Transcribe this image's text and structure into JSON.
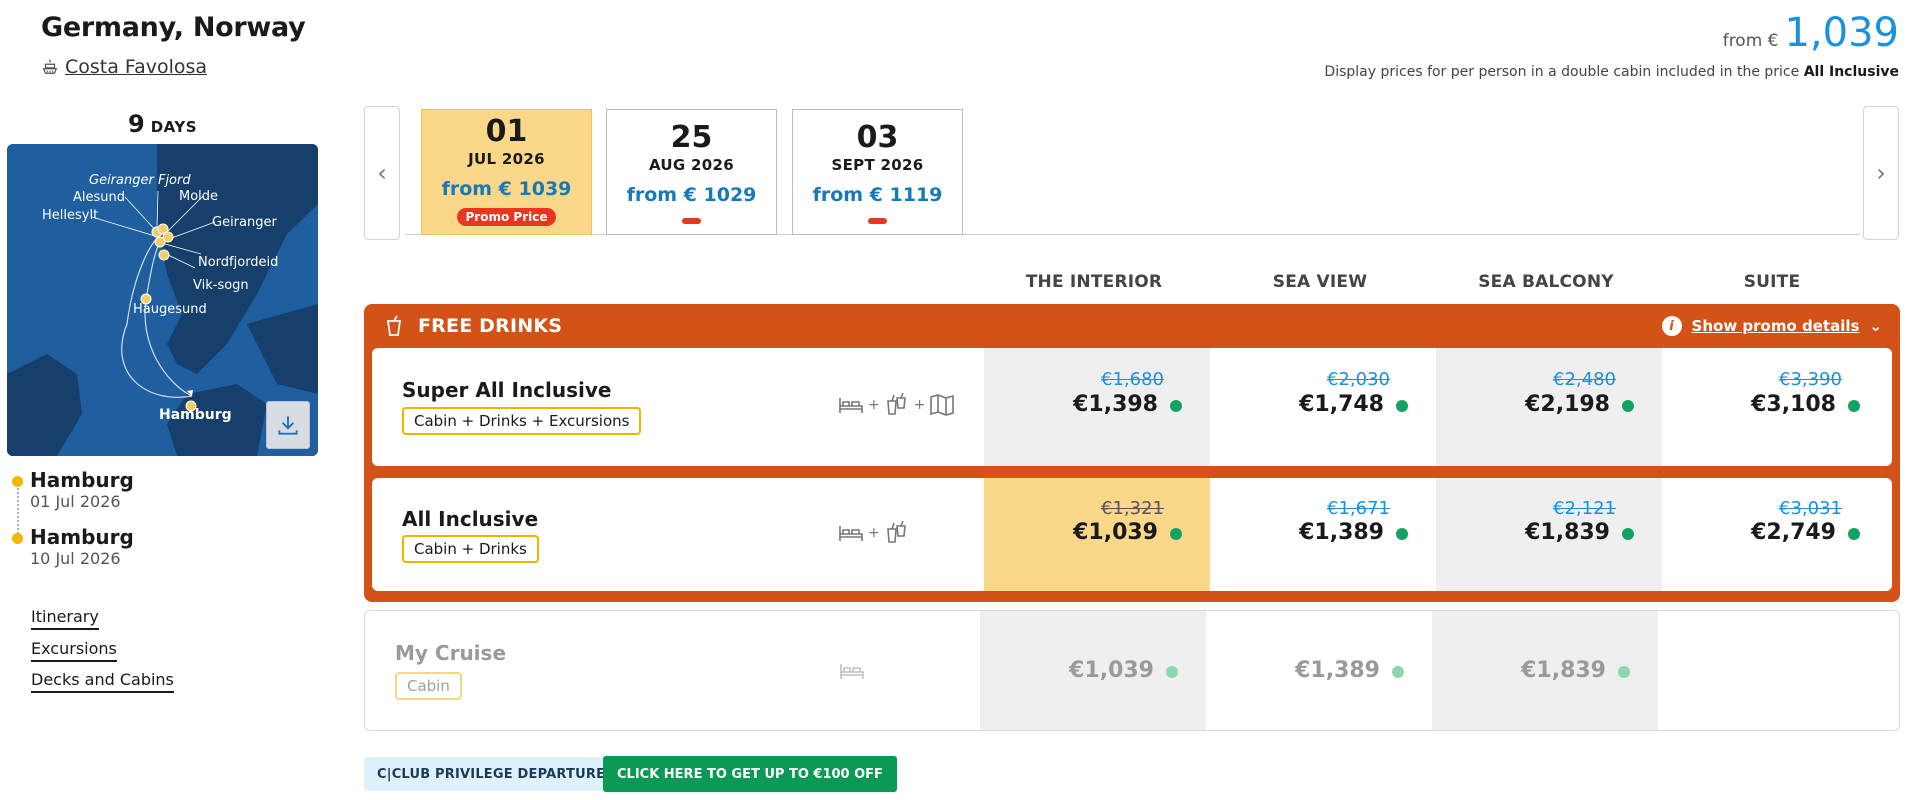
{
  "header": {
    "destination": "Germany, Norway",
    "ship_name": "Costa Favolosa",
    "from_label": "from €",
    "from_price": "1,039",
    "display_note_prefix": "Display prices for per person in a double cabin included in the price",
    "display_note_bold": "All Inclusive"
  },
  "trip": {
    "days_number": "9",
    "days_label": "DAYS",
    "map_labels": {
      "geiranger_fjord": "Geiranger Fjord",
      "alesund": "Alesund",
      "molde": "Molde",
      "hellesylt": "Hellesylt",
      "geiranger": "Geiranger",
      "nordfjordeid": "Nordfjordeid",
      "vik_sogn": "Vik-sogn",
      "haugesund": "Haugesund",
      "hamburg": "Hamburg"
    },
    "departure": {
      "port": "Hamburg",
      "date": "01 Jul 2026"
    },
    "arrival": {
      "port": "Hamburg",
      "date": "10 Jul 2026"
    }
  },
  "side_links": [
    "Itinerary",
    "Excursions",
    "Decks and Cabins"
  ],
  "dates": [
    {
      "day": "01",
      "month": "JUL 2026",
      "price": "from € 1039",
      "badge": "Promo Price",
      "active": true
    },
    {
      "day": "25",
      "month": "AUG 2026",
      "price": "from € 1029",
      "badge": "",
      "active": false
    },
    {
      "day": "03",
      "month": "SEPT 2026",
      "price": "from € 1119",
      "badge": "",
      "active": false
    }
  ],
  "nav": {
    "prev": "‹",
    "next": "›"
  },
  "columns": [
    "THE INTERIOR",
    "SEA VIEW",
    "SEA BALCONY",
    "SUITE"
  ],
  "promo": {
    "title": "FREE DRINKS",
    "details_link": "Show promo details",
    "info_glyph": "i",
    "chevron": "⌄"
  },
  "packages": [
    {
      "name": "Super All Inclusive",
      "tag": "Cabin + Drinks + Excursions",
      "icons": [
        "bed-icon",
        "drinks-icon",
        "map-icon"
      ],
      "plus": "+",
      "prices": [
        {
          "old": "€1,680",
          "new": "€1,398"
        },
        {
          "old": "€2,030",
          "new": "€1,748"
        },
        {
          "old": "€2,480",
          "new": "€2,198"
        },
        {
          "old": "€3,390",
          "new": "€3,108"
        }
      ]
    },
    {
      "name": "All Inclusive",
      "tag": "Cabin + Drinks",
      "icons": [
        "bed-icon",
        "drinks-icon"
      ],
      "plus": "+",
      "prices": [
        {
          "old": "€1,321",
          "new": "€1,039"
        },
        {
          "old": "€1,671",
          "new": "€1,389"
        },
        {
          "old": "€2,121",
          "new": "€1,839"
        },
        {
          "old": "€3,031",
          "new": "€2,749"
        }
      ]
    },
    {
      "name": "My Cruise",
      "tag": "Cabin",
      "icons": [
        "bed-icon"
      ],
      "prices": [
        {
          "new": "€1,039"
        },
        {
          "new": "€1,389"
        },
        {
          "new": "€1,839"
        }
      ]
    }
  ],
  "footer": {
    "club_label": "C|CLUB PRIVILEGE DEPARTURES",
    "discount_label": "CLICK HERE TO GET UP TO €100 OFF"
  },
  "colors": {
    "accent_blue": "#1a91dd",
    "promo_orange": "#d35218",
    "highlight_yellow": "#fbd78a",
    "available_green": "#12a363",
    "cta_green": "#0a9a55",
    "badge_red": "#e8361f"
  }
}
